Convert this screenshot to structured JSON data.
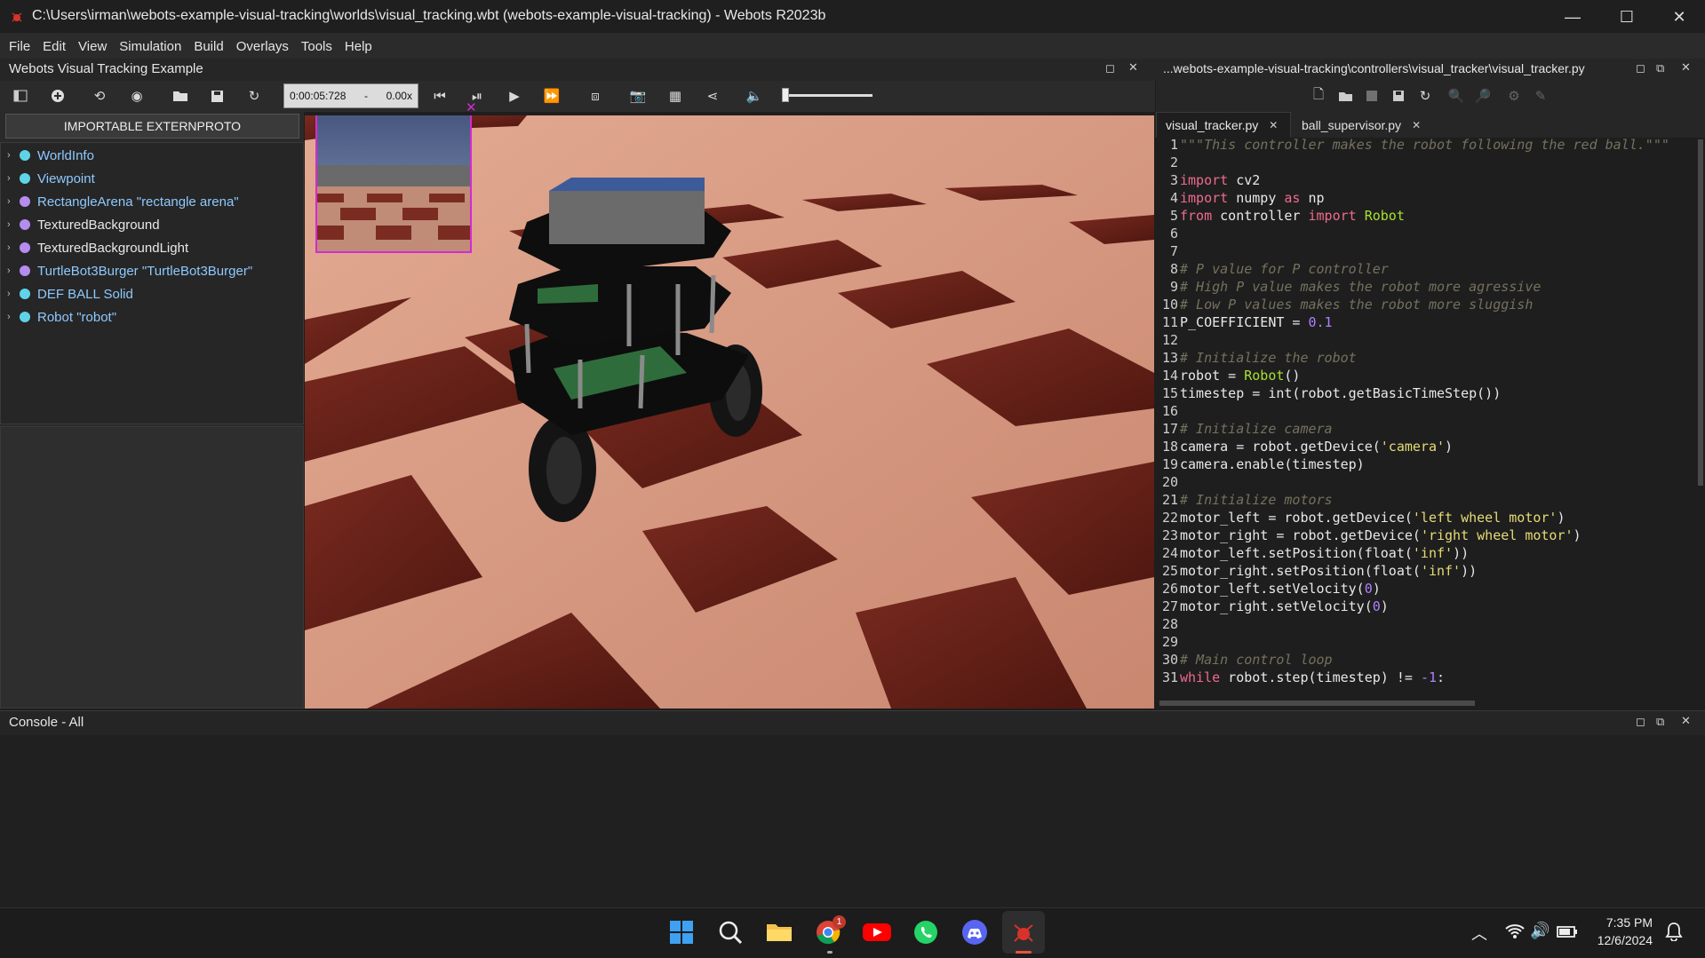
{
  "window": {
    "title": "C:\\Users\\irman\\webots-example-visual-tracking\\worlds\\visual_tracking.wbt (webots-example-visual-tracking) - Webots R2023b",
    "minimize_glyph": "—",
    "maximize_glyph": "☐",
    "close_glyph": "✕"
  },
  "menu": [
    "File",
    "Edit",
    "View",
    "Simulation",
    "Build",
    "Overlays",
    "Tools",
    "Help"
  ],
  "scene_panel": {
    "title": "Webots Visual Tracking Example",
    "importable_button": "IMPORTABLE EXTERNPROTO",
    "tree_items": [
      {
        "label": "WorldInfo",
        "color": "#5fd4e8",
        "text_color": "#8ec9ff"
      },
      {
        "label": "Viewpoint",
        "color": "#5fd4e8",
        "text_color": "#8ec9ff"
      },
      {
        "label": "RectangleArena \"rectangle arena\"",
        "color": "#b58cf0",
        "text_color": "#8ec9ff"
      },
      {
        "label": "TexturedBackground",
        "color": "#b58cf0",
        "text_color": "#e8e8e8"
      },
      {
        "label": "TexturedBackgroundLight",
        "color": "#b58cf0",
        "text_color": "#e8e8e8"
      },
      {
        "label": "TurtleBot3Burger \"TurtleBot3Burger\"",
        "color": "#b58cf0",
        "text_color": "#8ec9ff"
      },
      {
        "label": "DEF BALL Solid",
        "color": "#5fd4e8",
        "text_color": "#8ec9ff"
      },
      {
        "label": "Robot \"robot\"",
        "color": "#5fd4e8",
        "text_color": "#8ec9ff"
      }
    ]
  },
  "toolbar": {
    "time": "0:00:05:728",
    "speed_dash": "-",
    "speed": "0.00x",
    "volume_fraction": 0.05
  },
  "editor": {
    "path": "...webots-example-visual-tracking\\controllers\\visual_tracker\\visual_tracker.py",
    "tabs": [
      {
        "label": "visual_tracker.py",
        "active": true
      },
      {
        "label": "ball_supervisor.py",
        "active": false
      }
    ],
    "lines": [
      {
        "n": "1",
        "html": "<span class='cmt'>\"\"\"This controller makes the robot following the red ball.\"\"\"</span>"
      },
      {
        "n": "2",
        "html": ""
      },
      {
        "n": "3",
        "html": "<span class='kw'>import</span> cv2"
      },
      {
        "n": "4",
        "html": "<span class='kw'>import</span> numpy <span class='kw'>as</span> np"
      },
      {
        "n": "5",
        "html": "<span class='kw'>from</span> controller <span class='kw'>import</span> <span class='cls'>Robot</span>"
      },
      {
        "n": "6",
        "html": ""
      },
      {
        "n": "7",
        "html": ""
      },
      {
        "n": "8",
        "html": "<span class='cmt'># P value for P controller</span>"
      },
      {
        "n": "9",
        "html": "<span class='cmt'># High P value makes the robot more agressive</span>"
      },
      {
        "n": "10",
        "html": "<span class='cmt'># Low P values makes the robot more sluggish</span>"
      },
      {
        "n": "11",
        "html": "P_COEFFICIENT = <span class='num'>0.1</span>"
      },
      {
        "n": "12",
        "html": ""
      },
      {
        "n": "13",
        "html": "<span class='cmt'># Initialize the robot</span>"
      },
      {
        "n": "14",
        "html": "robot = <span class='cls'>Robot</span>()"
      },
      {
        "n": "15",
        "html": "timestep = int(robot.getBasicTimeStep())"
      },
      {
        "n": "16",
        "html": ""
      },
      {
        "n": "17",
        "html": "<span class='cmt'># Initialize camera</span>"
      },
      {
        "n": "18",
        "html": "camera = robot.getDevice(<span class='str'>'camera'</span>)"
      },
      {
        "n": "19",
        "html": "camera.enable(timestep)"
      },
      {
        "n": "20",
        "html": ""
      },
      {
        "n": "21",
        "html": "<span class='cmt'># Initialize motors</span>"
      },
      {
        "n": "22",
        "html": "motor_left = robot.getDevice(<span class='str'>'left wheel motor'</span>)"
      },
      {
        "n": "23",
        "html": "motor_right = robot.getDevice(<span class='str'>'right wheel motor'</span>)"
      },
      {
        "n": "24",
        "html": "motor_left.setPosition(float(<span class='str'>'inf'</span>))"
      },
      {
        "n": "25",
        "html": "motor_right.setPosition(float(<span class='str'>'inf'</span>))"
      },
      {
        "n": "26",
        "html": "motor_left.setVelocity(<span class='num'>0</span>)"
      },
      {
        "n": "27",
        "html": "motor_right.setVelocity(<span class='num'>0</span>)"
      },
      {
        "n": "28",
        "html": ""
      },
      {
        "n": "29",
        "html": ""
      },
      {
        "n": "30",
        "html": "<span class='cmt'># Main control loop</span>"
      },
      {
        "n": "31",
        "html": "<span class='kw'>while</span> robot.step(timestep) != <span class='num'>-1</span>:"
      }
    ]
  },
  "console": {
    "title": "Console - All"
  },
  "taskbar": {
    "time": "7:35 PM",
    "date": "12/6/2024",
    "chrome_badge": "1"
  }
}
